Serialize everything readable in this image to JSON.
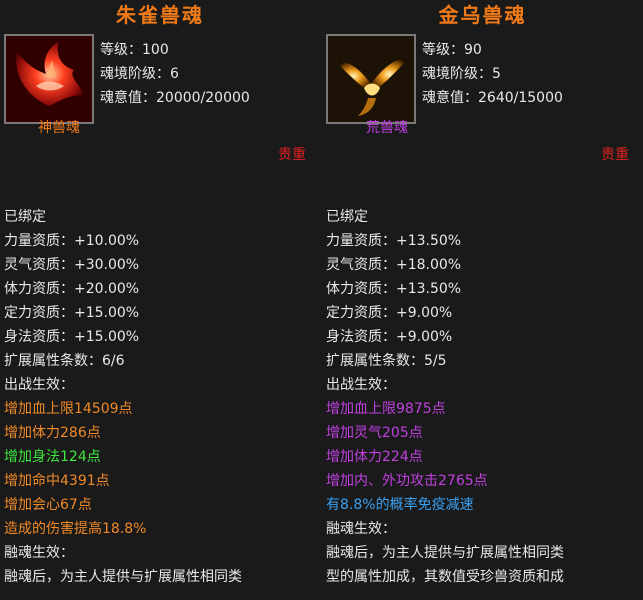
{
  "left": {
    "title": "朱雀兽魂",
    "stats": [
      "等级：100",
      "魂境阶级：6",
      "魂意值：20000/20000"
    ],
    "soul_type": "神兽魂",
    "soul_type_color": "#f07a18",
    "rarity": "贵重",
    "portrait_icon": "phoenix-icon",
    "lines": [
      {
        "text": "已绑定",
        "color": "#e8e8e8"
      },
      {
        "text": "力量资质：+10.00%",
        "color": "#e8e8e8"
      },
      {
        "text": "灵气资质：+30.00%",
        "color": "#e8e8e8"
      },
      {
        "text": "体力资质：+20.00%",
        "color": "#e8e8e8"
      },
      {
        "text": "定力资质：+15.00%",
        "color": "#e8e8e8"
      },
      {
        "text": "身法资质：+15.00%",
        "color": "#e8e8e8"
      },
      {
        "text": "扩展属性条数：6/6",
        "color": "#e8e8e8"
      },
      {
        "text": "出战生效：",
        "color": "#e8e8e8"
      },
      {
        "text": "增加血上限14509点",
        "color": "#f08a28"
      },
      {
        "text": "增加体力286点",
        "color": "#f08a28"
      },
      {
        "text": "增加身法124点",
        "color": "#3ee83e"
      },
      {
        "text": "增加命中4391点",
        "color": "#f08a28"
      },
      {
        "text": "增加会心67点",
        "color": "#f08a28"
      },
      {
        "text": "造成的伤害提高18.8%",
        "color": "#f08a28"
      },
      {
        "text": "融魂生效：",
        "color": "#e8e8e8"
      },
      {
        "text": "融魂后，为主人提供与扩展属性相同类",
        "color": "#e8e8e8"
      }
    ]
  },
  "right": {
    "title": "金乌兽魂",
    "stats": [
      "等级：90",
      "魂境阶级：5",
      "魂意值：2640/15000"
    ],
    "soul_type": "荒兽魂",
    "soul_type_color": "#c040e0",
    "rarity": "贵重",
    "portrait_icon": "golden-crow-icon",
    "lines": [
      {
        "text": "已绑定",
        "color": "#e8e8e8"
      },
      {
        "text": "力量资质：+13.50%",
        "color": "#e8e8e8"
      },
      {
        "text": "灵气资质：+18.00%",
        "color": "#e8e8e8"
      },
      {
        "text": "体力资质：+13.50%",
        "color": "#e8e8e8"
      },
      {
        "text": "定力资质：+9.00%",
        "color": "#e8e8e8"
      },
      {
        "text": "身法资质：+9.00%",
        "color": "#e8e8e8"
      },
      {
        "text": "扩展属性条数：5/5",
        "color": "#e8e8e8"
      },
      {
        "text": "出战生效：",
        "color": "#e8e8e8"
      },
      {
        "text": "增加血上限9875点",
        "color": "#c040e0"
      },
      {
        "text": "增加灵气205点",
        "color": "#c040e0"
      },
      {
        "text": "增加体力224点",
        "color": "#c040e0"
      },
      {
        "text": "增加内、外功攻击2765点",
        "color": "#c040e0"
      },
      {
        "text": "有8.8%的概率免疫减速",
        "color": "#3aa0f0"
      },
      {
        "text": "融魂生效：",
        "color": "#e8e8e8"
      },
      {
        "text": "融魂后，为主人提供与扩展属性相同类",
        "color": "#e8e8e8"
      },
      {
        "text": "型的属性加成，其数值受珍兽资质和成",
        "color": "#e8e8e8"
      }
    ]
  }
}
